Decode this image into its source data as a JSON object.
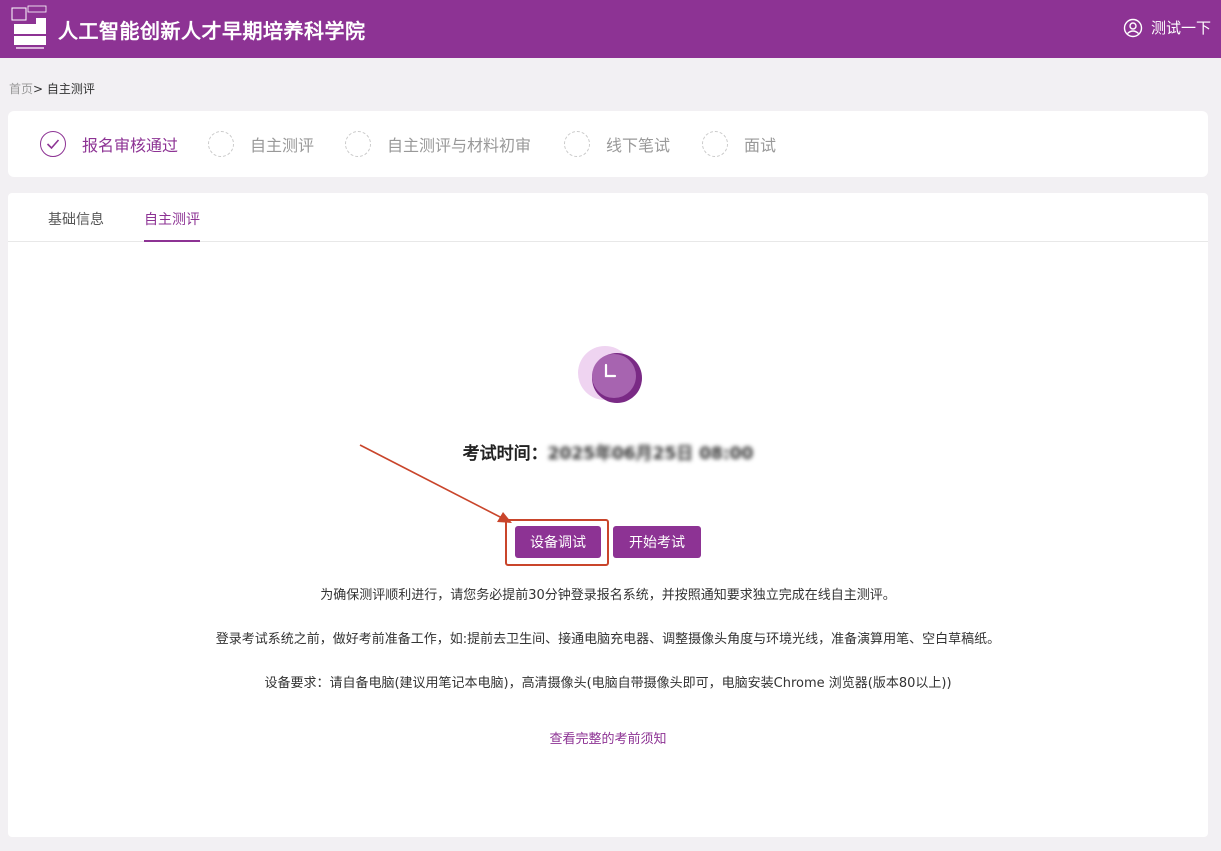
{
  "header": {
    "site_title": "人工智能创新人才早期培养科学院",
    "user_name": "测试一下"
  },
  "breadcrumb": {
    "home": "首页",
    "separator": "> ",
    "current": "自主测评"
  },
  "steps": [
    {
      "label": "报名审核通过",
      "status": "done"
    },
    {
      "label": "自主测评",
      "status": "pending"
    },
    {
      "label": "自主测评与材料初审",
      "status": "pending"
    },
    {
      "label": "线下笔试",
      "status": "pending"
    },
    {
      "label": "面试",
      "status": "pending"
    }
  ],
  "tabs": [
    {
      "label": "基础信息",
      "active": false
    },
    {
      "label": "自主测评",
      "active": true
    }
  ],
  "exam": {
    "time_label": "考试时间：",
    "time_value_blurred": "2025年06月25日 08:00"
  },
  "buttons": {
    "device_test": "设备调试",
    "start_exam": "开始考试"
  },
  "notes": [
    "为确保测评顺利进行，请您务必提前30分钟登录报名系统，并按照通知要求独立完成在线自主测评。",
    "登录考试系统之前，做好考前准备工作，如:提前去卫生间、接通电脑充电器、调整摄像头角度与环境光线，准备演算用笔、空白草稿纸。",
    "设备要求：请自备电脑(建议用笔记本电脑)，高清摄像头(电脑自带摄像头即可，电脑安装Chrome 浏览器(版本80以上))"
  ],
  "link_text": "查看完整的考前须知",
  "colors": {
    "brand": "#8d3394",
    "highlight": "#c9452b"
  }
}
